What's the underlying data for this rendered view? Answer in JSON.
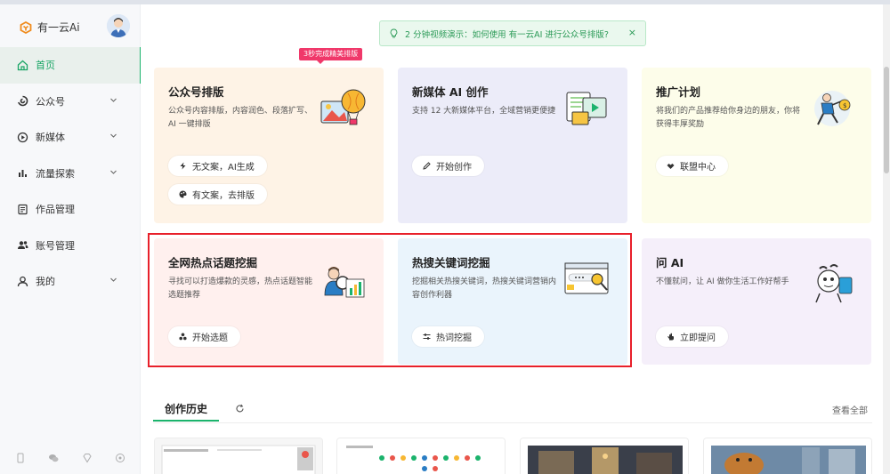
{
  "brand": {
    "name": "有一云Ai"
  },
  "sidebar": {
    "items": [
      {
        "label": "首页",
        "icon": "home-icon",
        "has_chevron": false,
        "active": true
      },
      {
        "label": "公众号",
        "icon": "swirl-icon",
        "has_chevron": true
      },
      {
        "label": "新媒体",
        "icon": "play-circle-icon",
        "has_chevron": true
      },
      {
        "label": "流量探索",
        "icon": "bar-chart-icon",
        "has_chevron": true
      },
      {
        "label": "作品管理",
        "icon": "document-icon",
        "has_chevron": false
      },
      {
        "label": "账号管理",
        "icon": "users-icon",
        "has_chevron": false
      },
      {
        "label": "我的",
        "icon": "user-icon",
        "has_chevron": true
      }
    ],
    "footer_icons": [
      "phone-icon",
      "wechat-icon",
      "diamond-icon",
      "settings-icon"
    ]
  },
  "banner": {
    "text": "2 分钟视频演示：如何使用 有一云AI 进行公众号排版?",
    "close": "×"
  },
  "badge": {
    "text": "3秒完成精美排版"
  },
  "cards": {
    "c1": {
      "title": "公众号排版",
      "desc": "公众号内容排版，内容润色、段落扩写、AI 一键排版",
      "btn1": "无文案，AI生成",
      "btn2": "有文案，去排版"
    },
    "c2": {
      "title": "新媒体 AI 创作",
      "desc": "支持 12 大新媒体平台，全域营销更便捷",
      "btn1": "开始创作"
    },
    "c3": {
      "title": "推广计划",
      "desc": "将我们的产品推荐给你身边的朋友，你将获得丰厚奖励",
      "btn1": "联盟中心"
    },
    "c4": {
      "title": "全网热点话题挖掘",
      "desc": "寻找可以打造爆款的灵感，热点话题智能选题推荐",
      "btn1": "开始选题"
    },
    "c5": {
      "title": "热搜关键词挖掘",
      "desc": "挖掘相关热搜关键词，热搜关键词营销内容创作利器",
      "btn1": "热词挖掘"
    },
    "c6": {
      "title": "问 AI",
      "desc": "不懂就问，让 AI 做你生活工作好帮手",
      "btn1": "立即提问"
    }
  },
  "history": {
    "tab": "创作历史",
    "view_all": "查看全部"
  },
  "colors": {
    "accent": "#1bb36c",
    "card1_bg": "#fef3e6",
    "card2_bg": "#ececf9",
    "card3_bg": "#fdfdea",
    "card4_bg": "#fff0ee",
    "card5_bg": "#eaf4fc",
    "card6_bg": "#f5effa",
    "highlight": "#e8202a",
    "badge": "#f0386a"
  }
}
